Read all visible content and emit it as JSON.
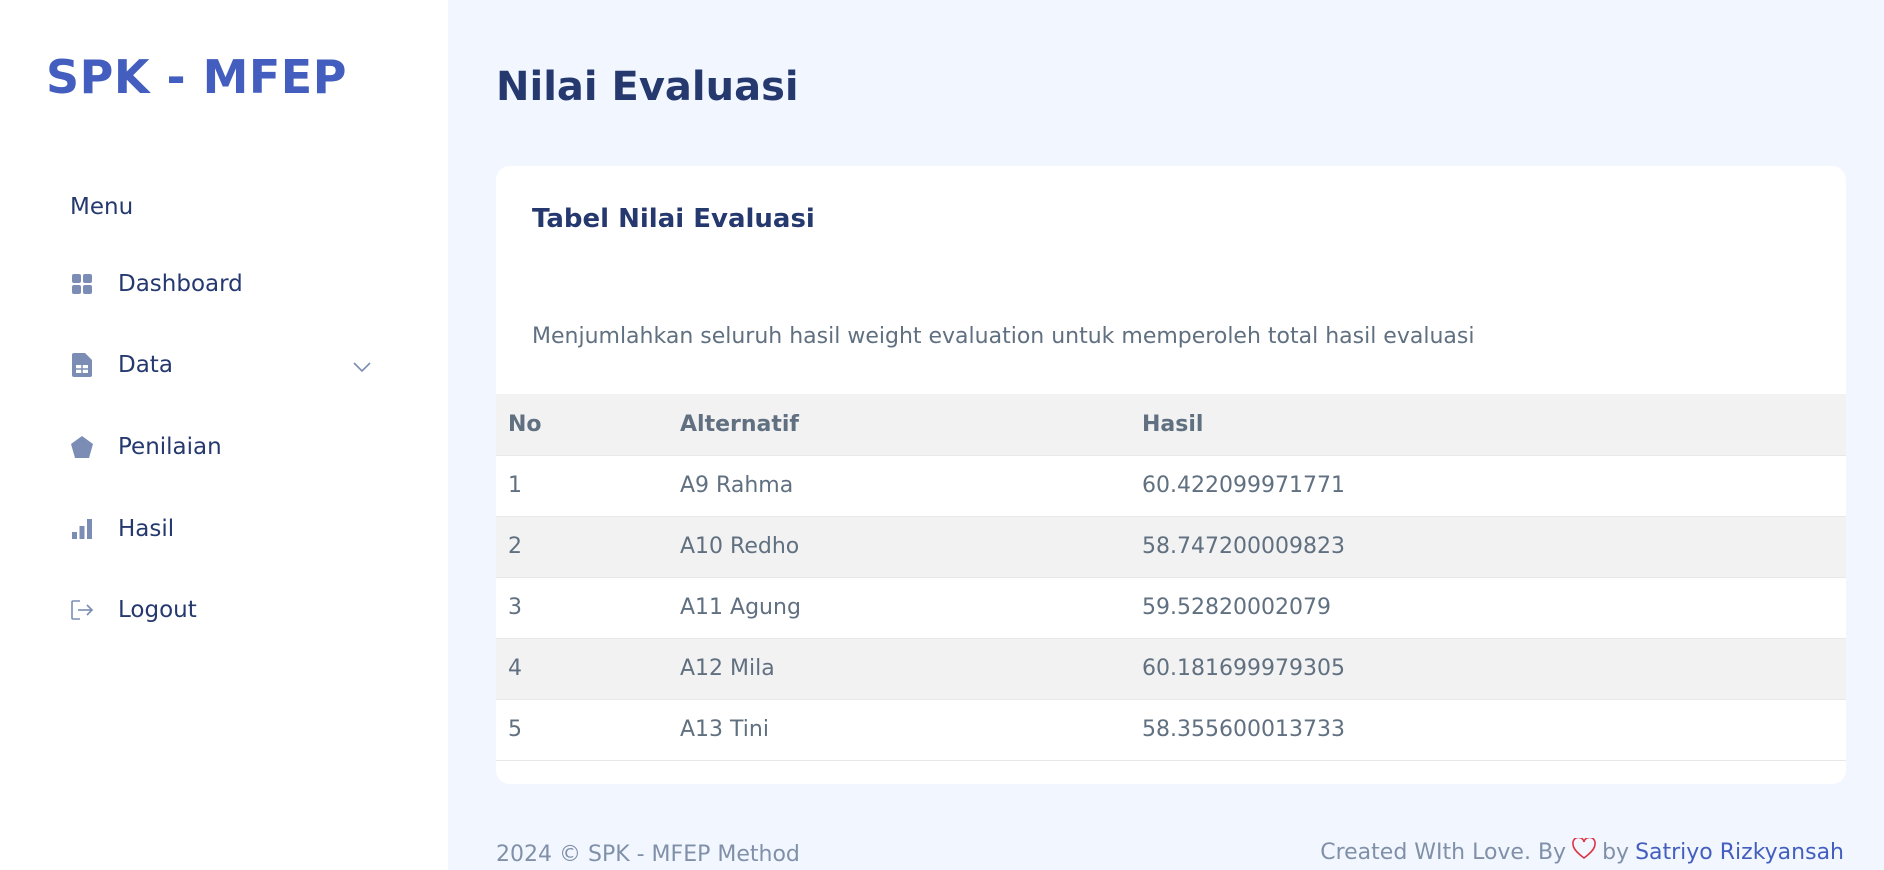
{
  "sidebar": {
    "brand": "SPK - MFEP",
    "menu_title": "Menu",
    "items": [
      {
        "label": "Dashboard",
        "icon": "grid-icon"
      },
      {
        "label": "Data",
        "icon": "file-spreadsheet-icon",
        "has_submenu": true
      },
      {
        "label": "Penilaian",
        "icon": "pentagon-icon"
      },
      {
        "label": "Hasil",
        "icon": "bar-chart-icon"
      },
      {
        "label": "Logout",
        "icon": "logout-icon"
      }
    ]
  },
  "main": {
    "page_title": "Nilai Evaluasi",
    "card": {
      "title": "Tabel Nilai Evaluasi",
      "description": "Menjumlahkan seluruh hasil weight evaluation untuk memperoleh total hasil evaluasi",
      "columns": [
        "No",
        "Alternatif",
        "Hasil"
      ],
      "rows": [
        {
          "no": "1",
          "alternatif": "A9 Rahma",
          "hasil": "60.422099971771"
        },
        {
          "no": "2",
          "alternatif": "A10 Redho",
          "hasil": "58.747200009823"
        },
        {
          "no": "3",
          "alternatif": "A11 Agung",
          "hasil": "59.52820002079"
        },
        {
          "no": "4",
          "alternatif": "A12 Mila",
          "hasil": "60.181699979305"
        },
        {
          "no": "5",
          "alternatif": "A13 Tini",
          "hasil": "58.355600013733"
        }
      ]
    }
  },
  "footer": {
    "left": "2024 © SPK - MFEP Method",
    "right_text": "Created WIth Love. By",
    "right_by": "by",
    "author": "Satriyo Rizkyansah"
  },
  "colors": {
    "accent": "#435ebe",
    "text_dark": "#25396f",
    "background": "#f2f7ff",
    "heart": "#dc3545"
  }
}
